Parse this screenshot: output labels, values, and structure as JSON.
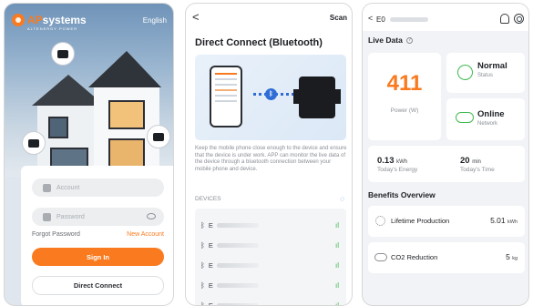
{
  "login": {
    "brand_prefix": "AP",
    "brand_name": "systems",
    "brand_tagline": "ALTENERGY POWER",
    "language": "English",
    "account_placeholder": "Account",
    "password_placeholder": "Password",
    "forgot_password": "Forgot Password",
    "new_account": "New Account",
    "sign_in": "Sign In",
    "direct_connect": "Direct Connect"
  },
  "bluetooth": {
    "back": "<",
    "scan": "Scan",
    "title": "Direct Connect (Bluetooth)",
    "bt_symbol": "ᛒ",
    "description": "Keep the mobile phone close enough to the device and ensure that the device is under work. APP can monitor the live data of the device through a bluetooth connection between your mobile phone and device.",
    "devices_label": "DEVICES",
    "devices": [
      {
        "prefix": "E",
        "signal": "ıl"
      },
      {
        "prefix": "E",
        "signal": "ıl"
      },
      {
        "prefix": "E",
        "signal": "ıl"
      },
      {
        "prefix": "E",
        "signal": "ıl"
      },
      {
        "prefix": "E",
        "signal": "ıl"
      }
    ]
  },
  "live": {
    "back": "<",
    "device_prefix": "E0",
    "title": "Live Data",
    "power_value": "411",
    "power_label": "Power (W)",
    "status_value": "Normal",
    "status_label": "Status",
    "network_value": "Online",
    "network_label": "Network",
    "energy_value": "0.13",
    "energy_unit": "kWh",
    "energy_label": "Today's Energy",
    "time_value": "20",
    "time_unit": "min",
    "time_label": "Today's Time",
    "benefits_title": "Benefits Overview",
    "lifetime_label": "Lifetime Production",
    "lifetime_value": "5.01",
    "lifetime_unit": "kWh",
    "co2_label": "CO2 Reduction",
    "co2_value": "5",
    "co2_unit": "kg"
  },
  "colors": {
    "accent": "#f97a1f",
    "signal": "#3fb950",
    "bluetooth": "#2f6dd6"
  }
}
